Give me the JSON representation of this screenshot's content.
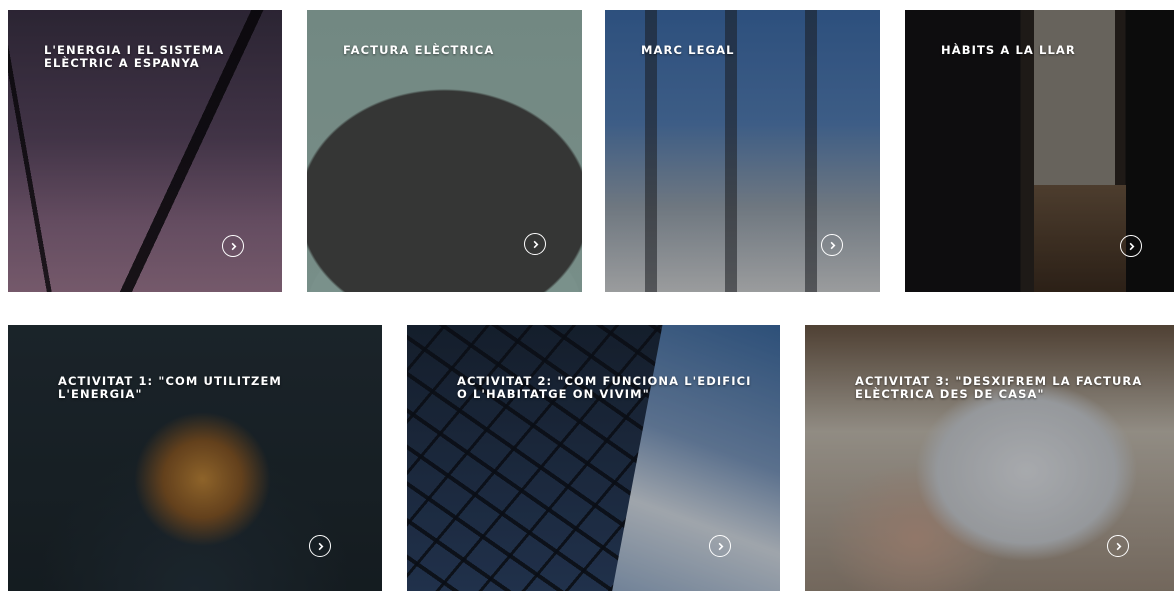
{
  "cards": [
    {
      "title": "L'ENERGIA I EL SISTEMA\nELÈCTRIC A ESPANYA",
      "icon": "chevron-right-icon"
    },
    {
      "title": "FACTURA ELÈCTRICA",
      "icon": "chevron-right-icon"
    },
    {
      "title": "MARC LEGAL",
      "icon": "chevron-right-icon"
    },
    {
      "title": "HÀBITS A LA LLAR",
      "icon": "chevron-right-icon"
    },
    {
      "title": "ACTIVITAT 1: \"COM UTILITZEM\nL'ENERGIA\"",
      "icon": "chevron-right-icon"
    },
    {
      "title": "ACTIVITAT 2: \"COM FUNCIONA L'EDIFICI\nO L'HABITATGE ON VIVIM\"",
      "icon": "chevron-right-icon"
    },
    {
      "title": "ACTIVITAT 3: \"DESXIFREM LA FACTURA\nELÈCTRICA DES DE CASA\"",
      "icon": "chevron-right-icon"
    }
  ],
  "colors": {
    "text": "#ffffff",
    "page_background": "#ffffff"
  }
}
